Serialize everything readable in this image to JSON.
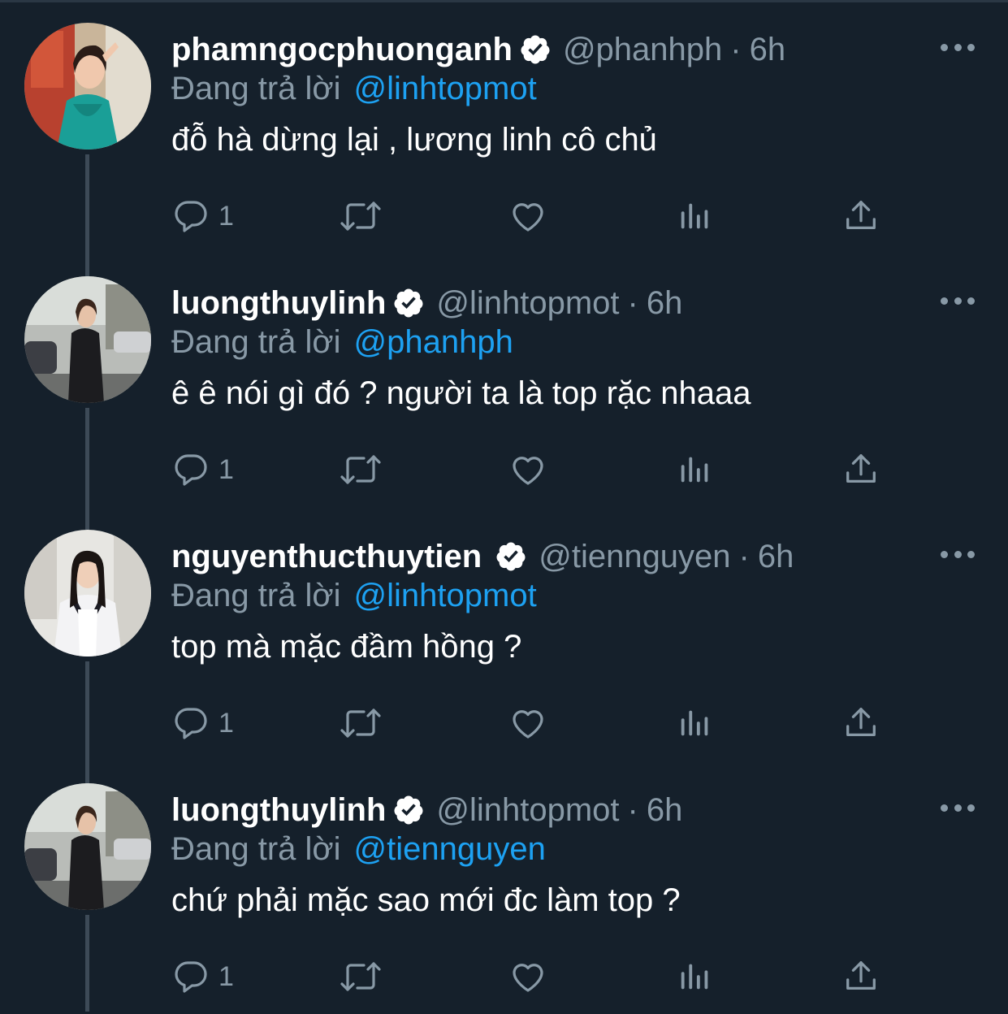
{
  "colors": {
    "background": "#15202b",
    "secondary_text": "#8899a6",
    "accent": "#1da1f2",
    "verified_badge": "#ffffff"
  },
  "icons": {
    "reply": "speech-bubble-icon",
    "retweet": "retweet-arrows-icon",
    "like": "heart-icon",
    "analytics": "bar-chart-icon",
    "share": "share-upload-icon",
    "more": "three-dots-icon",
    "verified": "verified-badge-icon"
  },
  "tweets": [
    {
      "display_name": "phamngocphuonganh",
      "handle": "@phanhph",
      "dot": "·",
      "time": "6h",
      "reply_prefix": "Đang trả lời",
      "reply_to": "@linhtopmot",
      "text": "đỗ hà dừng lại , lương linh cô chủ",
      "reply_count": "1"
    },
    {
      "display_name": "luongthuylinh",
      "handle": "@linhtopmot",
      "dot": "·",
      "time": "6h",
      "reply_prefix": "Đang trả lời",
      "reply_to": "@phanhph",
      "text": "ê ê nói gì đó ? người ta là top rặc nhaaa",
      "reply_count": "1"
    },
    {
      "display_name": "nguyenthucthuytien",
      "handle": "@tiennguyen",
      "dot": "·",
      "time": "6h",
      "reply_prefix": "Đang trả lời",
      "reply_to": "@linhtopmot",
      "text": "top mà mặc đầm hồng ?",
      "reply_count": "1"
    },
    {
      "display_name": "luongthuylinh",
      "handle": "@linhtopmot",
      "dot": "·",
      "time": "6h",
      "reply_prefix": "Đang trả lời",
      "reply_to": "@tiennguyen",
      "text": "chứ phải mặc sao mới đc làm top ?",
      "reply_count": "1"
    }
  ]
}
